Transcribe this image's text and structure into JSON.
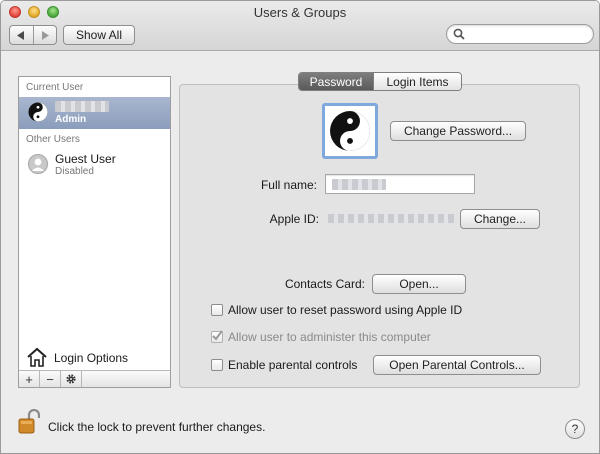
{
  "window": {
    "title": "Users & Groups",
    "toolbar": {
      "show_all_label": "Show All",
      "back_icon": "chevron-left-icon",
      "forward_icon": "chevron-right-icon"
    },
    "search": {
      "placeholder": "",
      "icon": "search-icon"
    }
  },
  "sidebar": {
    "current_user_header": "Current User",
    "current_user": {
      "name": "",
      "role": "Admin",
      "avatar": "yin-yang-icon"
    },
    "other_users_header": "Other Users",
    "other_users": [
      {
        "name": "Guest User",
        "status": "Disabled",
        "avatar": "person-silhouette-icon"
      }
    ],
    "login_options_label": "Login Options",
    "tools": {
      "add": "+",
      "remove": "−",
      "settings": "gear-icon"
    }
  },
  "tabs": [
    {
      "label": "Password",
      "active": true
    },
    {
      "label": "Login Items",
      "active": false
    }
  ],
  "password_pane": {
    "change_password_label": "Change Password...",
    "full_name_label": "Full name:",
    "full_name_value": "",
    "apple_id_label": "Apple ID:",
    "apple_id_value": "",
    "apple_id_change_label": "Change...",
    "contacts_card_label": "Contacts Card:",
    "contacts_open_label": "Open...",
    "checkboxes": [
      {
        "label": "Allow user to reset password using Apple ID",
        "checked": false,
        "disabled": false
      },
      {
        "label": "Allow user to administer this computer",
        "checked": true,
        "disabled": true
      },
      {
        "label": "Enable parental controls",
        "checked": false,
        "disabled": false
      }
    ],
    "open_parental_controls_label": "Open Parental Controls..."
  },
  "footer": {
    "lock_text": "Click the lock to prevent further changes.",
    "lock_icon": "lock-open-icon",
    "help_label": "?"
  },
  "colors": {
    "selection": "#8b9dbc",
    "focus_ring": "#7fa8dc",
    "active_tab": "#5a5a5a"
  }
}
